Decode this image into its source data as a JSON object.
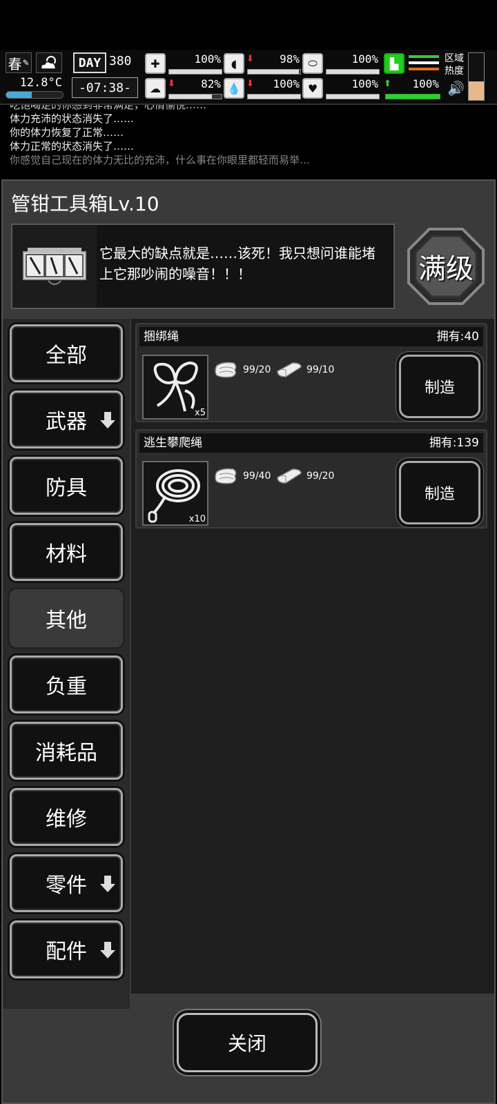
{
  "hud": {
    "season": "春",
    "temperature": "12.8°C",
    "temperature_fill": 0.45,
    "day_label": "DAY",
    "day_number": "380",
    "clock": "-07:38-",
    "stats": [
      {
        "name": "health",
        "icon": "medkit-icon",
        "arrow": "",
        "value": "100%",
        "fill": 1.0
      },
      {
        "name": "hunger",
        "icon": "stomach-icon",
        "arrow": "down",
        "value": "98%",
        "fill": 0.98
      },
      {
        "name": "medicine",
        "icon": "pill-icon",
        "arrow": "",
        "value": "100%",
        "fill": 1.0
      },
      {
        "name": "mood",
        "icon": "brain-icon",
        "arrow": "down",
        "value": "82%",
        "fill": 0.82
      },
      {
        "name": "thirst",
        "icon": "water-drop-icon",
        "arrow": "down",
        "value": "100%",
        "fill": 1.0
      },
      {
        "name": "heart",
        "icon": "heart-icon",
        "arrow": "",
        "value": "100%",
        "fill": 1.0
      }
    ],
    "stamina": {
      "arrow": "up",
      "value": "100%",
      "fill": 1.0
    },
    "zone_label": "区域热度",
    "zone_heat_fill": 0.4
  },
  "log": {
    "lines": [
      "吃饱喝足的你感到非常满足，心情愉悦……",
      "体力充沛的状态消失了……",
      "你的体力恢复了正常……",
      "体力正常的状态消失了……",
      "你感觉自己现在的体力无比的充沛，什么事在你眼里都轻而易举…"
    ]
  },
  "dialog": {
    "title": "管钳工具箱Lv.10",
    "description": "它最大的缺点就是……该死！我只想问谁能堵上它那吵闹的噪音！！！",
    "max_level_label": "满级",
    "categories": [
      {
        "label": "全部",
        "dropdown": false,
        "active": false
      },
      {
        "label": "武器",
        "dropdown": true,
        "active": false
      },
      {
        "label": "防具",
        "dropdown": false,
        "active": false
      },
      {
        "label": "材料",
        "dropdown": false,
        "active": false
      },
      {
        "label": "其他",
        "dropdown": false,
        "active": true
      },
      {
        "label": "负重",
        "dropdown": false,
        "active": false
      },
      {
        "label": "消耗品",
        "dropdown": false,
        "active": false
      },
      {
        "label": "维修",
        "dropdown": false,
        "active": false
      },
      {
        "label": "零件",
        "dropdown": true,
        "active": false
      },
      {
        "label": "配件",
        "dropdown": true,
        "active": false
      }
    ],
    "recipes": [
      {
        "name": "捆绑绳",
        "owned": "拥有:40",
        "count": "x5",
        "icon": "rope-icon",
        "materials": [
          {
            "icon": "cloth-icon",
            "text": "99/20"
          },
          {
            "icon": "fabric-roll-icon",
            "text": "99/10"
          }
        ],
        "button": "制造"
      },
      {
        "name": "逃生攀爬绳",
        "owned": "拥有:139",
        "count": "x10",
        "icon": "climbing-rope-icon",
        "materials": [
          {
            "icon": "cloth-icon",
            "text": "99/40"
          },
          {
            "icon": "fabric-roll-icon",
            "text": "99/20"
          }
        ],
        "button": "制造"
      }
    ],
    "close_label": "关闭"
  }
}
